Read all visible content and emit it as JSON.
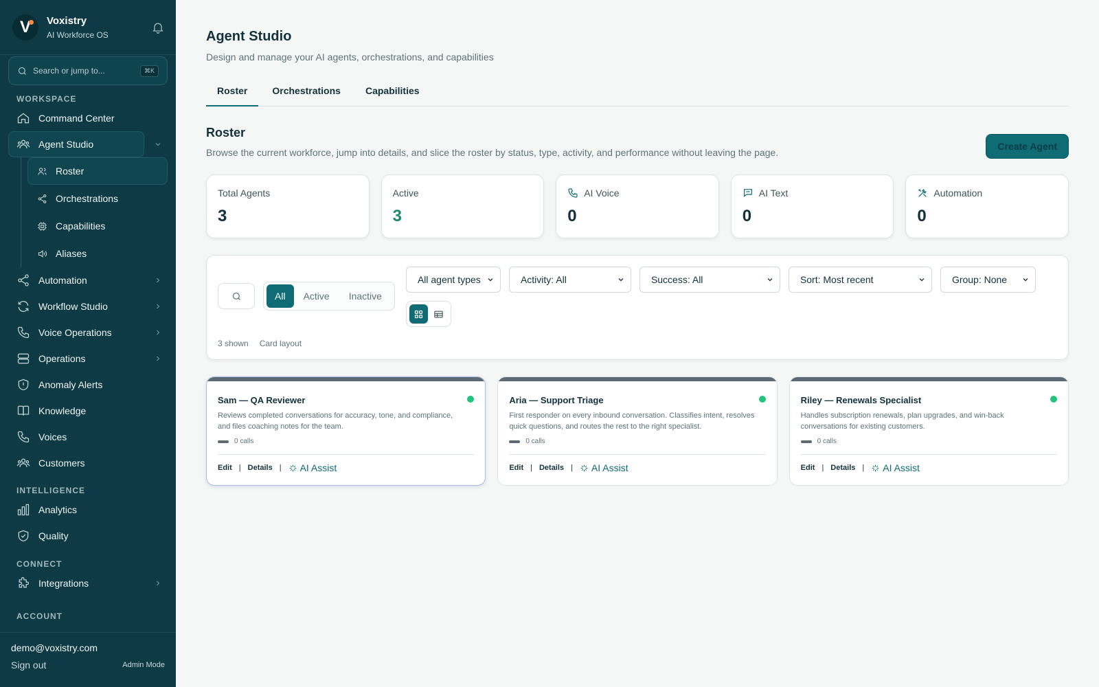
{
  "brand": {
    "name": "Voxistry",
    "subtitle": "AI Workforce OS",
    "logo_letter": "V"
  },
  "sidebar": {
    "search_placeholder": "Search or jump to...",
    "search_shortcut": "⌘K",
    "sections": {
      "workspace": "WORKSPACE",
      "intelligence": "INTELLIGENCE",
      "connect": "CONNECT",
      "account": "ACCOUNT"
    },
    "items": {
      "command_center": "Command Center",
      "agent_studio": "Agent Studio",
      "roster": "Roster",
      "orchestrations": "Orchestrations",
      "capabilities": "Capabilities",
      "aliases": "Aliases",
      "automation": "Automation",
      "workflow_studio": "Workflow Studio",
      "voice_operations": "Voice Operations",
      "operations": "Operations",
      "anomaly_alerts": "Anomaly Alerts",
      "knowledge": "Knowledge",
      "voices": "Voices",
      "customers": "Customers",
      "analytics": "Analytics",
      "quality": "Quality",
      "integrations": "Integrations"
    },
    "footer": {
      "email": "demo@voxistry.com",
      "sign_out": "Sign out",
      "mode": "Admin Mode"
    }
  },
  "page": {
    "title": "Agent Studio",
    "subtitle": "Design and manage your AI agents, orchestrations, and capabilities",
    "tabs": [
      "Roster",
      "Orchestrations",
      "Capabilities"
    ],
    "active_tab": "Roster"
  },
  "roster": {
    "title": "Roster",
    "description": "Browse the current workforce, jump into details, and slice the roster by status, type, activity, and performance without leaving the page.",
    "create_button": "Create Agent"
  },
  "stats": [
    {
      "label": "Total Agents",
      "value": "3"
    },
    {
      "label": "Active",
      "value": "3"
    },
    {
      "label": "AI Voice",
      "value": "0"
    },
    {
      "label": "AI Text",
      "value": "0"
    },
    {
      "label": "Automation",
      "value": "0"
    }
  ],
  "filters": {
    "status_options": [
      "All",
      "Active",
      "Inactive"
    ],
    "status_selected": "All",
    "agent_type": "All agent types",
    "activity": "Activity: All",
    "success": "Success: All",
    "sort": "Sort: Most recent",
    "group": "Group: None",
    "shown_count": "3 shown",
    "layout_label": "Card layout",
    "view_mode": "grid"
  },
  "agents": [
    {
      "name": "Sam — QA Reviewer",
      "description": "Reviews completed conversations for accuracy, tone, and compliance, and files coaching notes for the team.",
      "calls": "0 calls",
      "status": "active"
    },
    {
      "name": "Aria — Support Triage",
      "description": "First responder on every inbound conversation. Classifies intent, resolves quick questions, and routes the rest to the right specialist.",
      "calls": "0 calls",
      "status": "active"
    },
    {
      "name": "Riley — Renewals Specialist",
      "description": "Handles subscription renewals, plan upgrades, and win-back conversations for existing customers.",
      "calls": "0 calls",
      "status": "active"
    }
  ],
  "card_actions": {
    "edit": "Edit",
    "details": "Details",
    "assist": "AI Assist",
    "separator": "|"
  },
  "colors": {
    "sidebar_bg": "#0d3a44",
    "accent": "#0f6b74",
    "active_value": "#1c8a6a",
    "status_active": "#22c47a"
  }
}
